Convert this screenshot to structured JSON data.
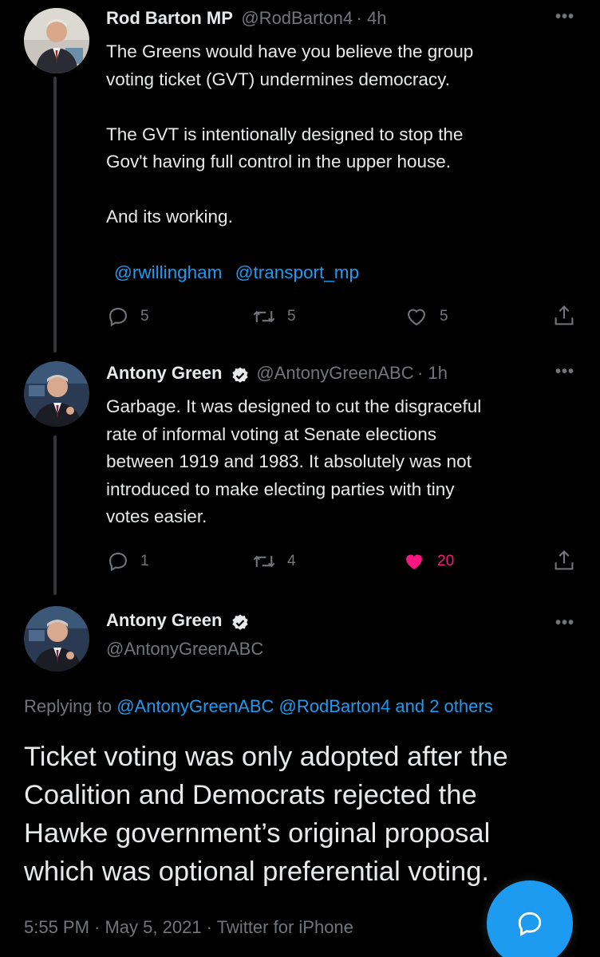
{
  "tweets": [
    {
      "name": "Rod Barton MP",
      "handle": "@RodBarton4",
      "time": "· 4h",
      "text": "The Greens would have you believe the group\nvoting ticket (GVT) undermines democracy.\n\nThe GVT is intentionally designed to stop the\nGov't having full control in the upper house.\n\nAnd its working.",
      "mentions": [
        "@rwillingham",
        "@transport_mp"
      ],
      "replies": "5",
      "retweets": "5",
      "likes": "5"
    },
    {
      "name": "Antony Green",
      "handle": "@AntonyGreenABC",
      "time": "· 1h",
      "text": "Garbage. It was designed to cut the disgraceful\nrate of informal voting at Senate elections\nbetween 1919 and 1983. It absolutely was not\nintroduced to make electing parties with tiny\nvotes easier.",
      "replies": "1",
      "retweets": "4",
      "likes": "20"
    }
  ],
  "focus": {
    "name": "Antony Green",
    "handle": "@AntonyGreenABC",
    "replying_prefix": "Replying to",
    "replying_to": "@AntonyGreenABC @RodBarton4 and 2 others",
    "text": "Ticket voting was only adopted after the\nCoalition and Democrats rejected the\nHawke government’s original proposal\nwhich was optional preferential voting.",
    "timestamp": "5:55 PM · May 5, 2021 · Twitter for iPhone"
  },
  "colors": {
    "background": "#000000",
    "accent": "#1d9bf0",
    "like_active": "#f91880",
    "muted": "#71767b"
  },
  "icons": [
    "reply-icon",
    "retweet-icon",
    "like-icon",
    "share-icon",
    "more-icon",
    "verified-icon",
    "compose-reply-icon"
  ]
}
